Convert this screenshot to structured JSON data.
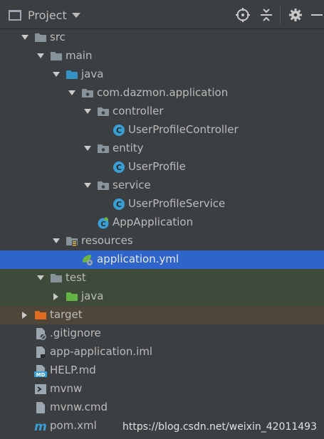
{
  "header": {
    "title": "Project",
    "icons": [
      "project-view-icon",
      "dropdown-chevron-icon",
      "locate-target-icon",
      "collapse-all-icon",
      "settings-gear-icon",
      "hide-minimize-icon"
    ]
  },
  "tree": {
    "items": [
      {
        "label": "src",
        "icon": "folder-icon",
        "expanded": true
      },
      {
        "label": "main",
        "icon": "folder-icon",
        "expanded": true
      },
      {
        "label": "java",
        "icon": "source-folder-icon",
        "expanded": true
      },
      {
        "label": "com.dazmon.application",
        "icon": "package-icon",
        "expanded": true
      },
      {
        "label": "controller",
        "icon": "package-icon",
        "expanded": true
      },
      {
        "label": "UserProfileController",
        "icon": "java-class-icon"
      },
      {
        "label": "entity",
        "icon": "package-icon",
        "expanded": true
      },
      {
        "label": "UserProfile",
        "icon": "java-class-icon"
      },
      {
        "label": "service",
        "icon": "package-icon",
        "expanded": true
      },
      {
        "label": "UserProfileService",
        "icon": "java-class-icon"
      },
      {
        "label": "AppApplication",
        "icon": "spring-boot-class-icon"
      },
      {
        "label": "resources",
        "icon": "resources-folder-icon",
        "expanded": true
      },
      {
        "label": "application.yml",
        "icon": "spring-yml-icon",
        "selected": true
      },
      {
        "label": "test",
        "icon": "folder-icon",
        "expanded": true
      },
      {
        "label": "java",
        "icon": "test-source-folder-icon",
        "expanded": false
      },
      {
        "label": "target",
        "icon": "excluded-folder-icon",
        "expanded": false
      },
      {
        "label": ".gitignore",
        "icon": "ignored-file-icon"
      },
      {
        "label": "app-application.iml",
        "icon": "iml-file-icon"
      },
      {
        "label": "HELP.md",
        "icon": "markdown-file-icon"
      },
      {
        "label": "mvnw",
        "icon": "shell-file-icon"
      },
      {
        "label": "mvnw.cmd",
        "icon": "text-file-icon"
      },
      {
        "label": "pom.xml",
        "icon": "maven-file-icon"
      }
    ]
  },
  "watermark": "https://blog.csdn.net/weixin_42011493",
  "colors": {
    "background": "#3c3f41",
    "selection": "#2f65ca",
    "test_row": "#3e4b3a",
    "target_row": "#4e4638",
    "text": "#bbbbbb",
    "folder": "#87939a",
    "source_folder": "#3592c4",
    "test_folder": "#62b543",
    "excluded_folder": "#e06a1e",
    "class_icon": "#389fd6"
  }
}
